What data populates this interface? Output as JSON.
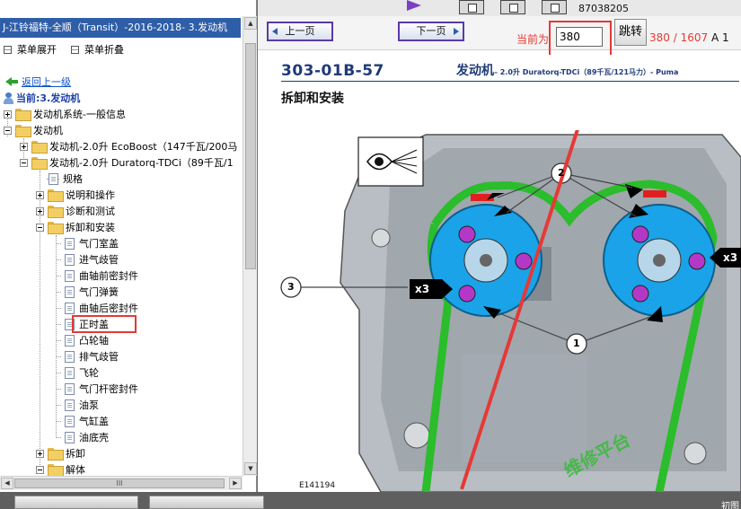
{
  "left_panel": {
    "title": "J-江铃福特-全顺（Transit）-2016-2018- 3.发动机",
    "expand_label": "菜单展开",
    "collapse_label": "菜单折叠",
    "back_label": "返回上一级",
    "current_label": "当前:3.发动机",
    "tree": [
      {
        "label": "发动机系统-一般信息"
      },
      {
        "label": "发动机"
      },
      {
        "label": "发动机-2.0升 EcoBoost（147千瓦/200马"
      },
      {
        "label": "发动机-2.0升 Duratorq-TDCi（89千瓦/1"
      },
      {
        "label": "规格"
      },
      {
        "label": "说明和操作"
      },
      {
        "label": "诊断和测试"
      },
      {
        "label": "拆卸和安装"
      },
      {
        "label": "气门室盖"
      },
      {
        "label": "进气歧管"
      },
      {
        "label": "曲轴前密封件"
      },
      {
        "label": "气门弹簧"
      },
      {
        "label": "曲轴后密封件"
      },
      {
        "label": "正时盖"
      },
      {
        "label": "凸轮轴"
      },
      {
        "label": "排气歧管"
      },
      {
        "label": "飞轮"
      },
      {
        "label": "气门杆密封件"
      },
      {
        "label": "油泵"
      },
      {
        "label": "气缸盖"
      },
      {
        "label": "油底壳"
      },
      {
        "label": "拆卸"
      },
      {
        "label": "解体"
      }
    ],
    "hscroll_grip": "III"
  },
  "toolbar": {
    "phone_fragment": "87038205",
    "prev_label": "上一页",
    "next_label": "下一页",
    "current_page_label": "当前为",
    "page_value": "380",
    "go_label": "跳转",
    "page_count": "380 / 1607",
    "page_suffix": "A 1"
  },
  "document": {
    "code": "303-01B-57",
    "header_main": "发动机",
    "header_sub": "– 2.0升 Duratorq-TDCi（89千瓦/121马力）- Puma",
    "section_title": "拆卸和安装",
    "figure_id": "E141194",
    "callouts": [
      "1",
      "2",
      "3"
    ],
    "multiplier_label": "x3",
    "watermark": "维修平台"
  },
  "bottom_bar": {
    "right_text": "初图"
  },
  "colors": {
    "title_bar": "#2f5ea8",
    "highlight": "#e53935",
    "button_border": "#5a3aa8",
    "chain": "#2bbd2b",
    "gear": "#1aa3e8",
    "bolt": "#b537c8"
  }
}
